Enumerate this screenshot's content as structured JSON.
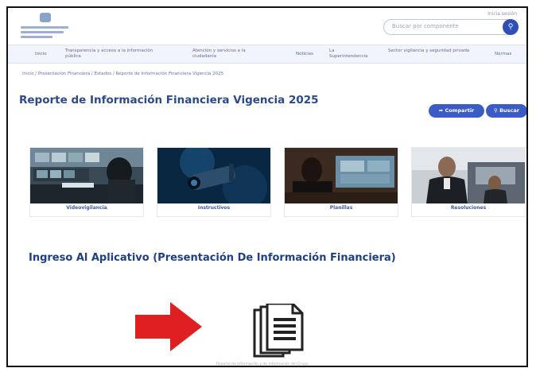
{
  "header": {
    "top_link": "Inicia sesión",
    "search_placeholder": "Buscar por componente"
  },
  "nav": {
    "items": [
      "Inicio",
      "Transparencia y acceso a la información pública",
      "Atención y servicios a la ciudadanía",
      "Noticias",
      "La Superintendencia",
      "Sector vigilancia y seguridad privada",
      "Normas"
    ]
  },
  "breadcrumb": "Inicio / Presentación Financiera / Estados / Reporte de Información Financiera Vigencia 2025",
  "page": {
    "title": "Reporte de Información Financiera Vigencia 2025",
    "share_label": "Compartir",
    "search_label": "Buscar"
  },
  "cards": [
    {
      "label": "Videovigilancia"
    },
    {
      "label": "Instructivos"
    },
    {
      "label": "Planillas"
    },
    {
      "label": "Resoluciones"
    }
  ],
  "section": {
    "title": "Ingreso Al Aplicativo (Presentación De Información Financiera)"
  },
  "footnote": "Reporte de Información y de Información del Grupo",
  "colors": {
    "primary": "#2a4a8c",
    "accent": "#3b5cc4",
    "arrow": "#e02020"
  }
}
